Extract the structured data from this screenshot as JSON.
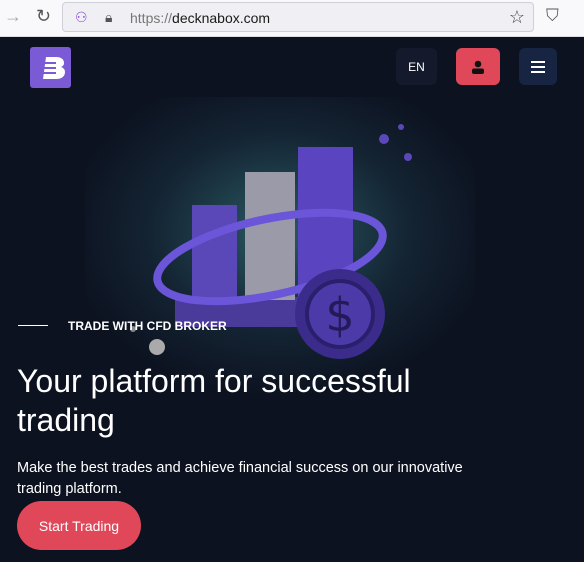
{
  "browser": {
    "url_prefix": "https://",
    "url_domain": "decknabox.com"
  },
  "header": {
    "language": "EN",
    "user_icon": "user-icon",
    "menu_icon": "hamburger-icon"
  },
  "hero": {
    "kicker": "TRADE WITH CFD BROKER",
    "title": "Your platform for successful trading",
    "description": "Make the best trades and achieve financial success on our innovative trading platform.",
    "cta": "Start Trading"
  },
  "colors": {
    "accent": "#e0485a",
    "brand": "#7b5ad6",
    "background": "#0c1220"
  }
}
